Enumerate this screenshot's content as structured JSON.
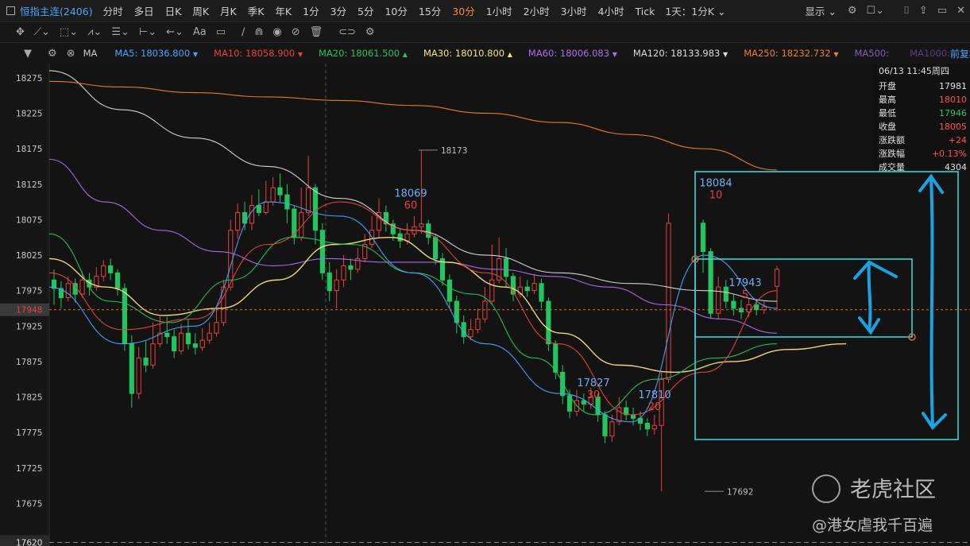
{
  "topbar": {
    "title": "恒指主连(2406)",
    "timeframes": [
      "分时",
      "多日",
      "日K",
      "周K",
      "月K",
      "季K",
      "年K",
      "1分",
      "3分",
      "5分",
      "10分",
      "15分",
      "30分",
      "1小时",
      "2小时",
      "3小时",
      "4小时",
      "Tick"
    ],
    "active_timeframe": "30分",
    "period_select": "1天：1分K",
    "display_label": "显示"
  },
  "mabar": {
    "ma_label": "MA",
    "items": [
      {
        "label": "MA5:",
        "value": "18036.800",
        "color": "#4aa3ff",
        "arrow": "▼"
      },
      {
        "label": "MA10:",
        "value": "18058.900",
        "color": "#e8413a",
        "arrow": "▼"
      },
      {
        "label": "MA20:",
        "value": "18061.500",
        "color": "#22c55e",
        "arrow": "▲"
      },
      {
        "label": "MA30:",
        "value": "18010.800",
        "color": "#f5e27a",
        "arrow": "▲"
      },
      {
        "label": "MA60:",
        "value": "18006.083",
        "color": "#b06cf0",
        "arrow": "▼"
      },
      {
        "label": "MA120:",
        "value": "18133.983",
        "color": "#dcdcdc",
        "arrow": "▼"
      },
      {
        "label": "MA250:",
        "value": "18232.732",
        "color": "#f07e22",
        "arrow": "▼"
      },
      {
        "label": "MA500:",
        "value": "",
        "color": "#8a5ab8",
        "arrow": ""
      }
    ],
    "ma1000_label": "MA1000:",
    "restore_label": "前复权"
  },
  "info_panel": {
    "datetime": "06/13 11:45周四",
    "rows": [
      {
        "label": "开盘",
        "value": "17981",
        "color": "#e0e0e0"
      },
      {
        "label": "最高",
        "value": "18010",
        "color": "#ff4d4d"
      },
      {
        "label": "最低",
        "value": "17946",
        "color": "#22c55e"
      },
      {
        "label": "收盘",
        "value": "18005",
        "color": "#ff4d4d"
      },
      {
        "label": "涨跌额",
        "value": "+24",
        "color": "#ff4d4d"
      },
      {
        "label": "涨跌幅",
        "value": "+0.13%",
        "color": "#ff4d4d"
      },
      {
        "label": "成交量",
        "value": "4304",
        "color": "#e0e0e0"
      }
    ]
  },
  "chart_data": {
    "type": "candlestick",
    "y_ticks": [
      18275,
      18225,
      18175,
      18125,
      18075,
      18025,
      17975,
      17925,
      17875,
      17825,
      17775,
      17725,
      17675
    ],
    "ylim": [
      17615,
      18295
    ],
    "current_price": "17948",
    "bottom_price": "17620",
    "up_color": "#e8413a",
    "down_color": "#22c55e",
    "candles": [
      [
        17990,
        17978,
        18005,
        17955
      ],
      [
        17978,
        17965,
        17988,
        17950
      ],
      [
        17965,
        17985,
        17995,
        17960
      ],
      [
        17985,
        17970,
        17992,
        17958
      ],
      [
        17970,
        17990,
        18002,
        17965
      ],
      [
        17990,
        17980,
        18000,
        17968
      ],
      [
        17980,
        17995,
        18008,
        17975
      ],
      [
        17995,
        18010,
        18018,
        17988
      ],
      [
        18010,
        18000,
        18020,
        17990
      ],
      [
        18000,
        17978,
        18005,
        17968
      ],
      [
        17978,
        17900,
        17985,
        17890
      ],
      [
        17900,
        17830,
        17912,
        17810
      ],
      [
        17830,
        17880,
        17895,
        17822
      ],
      [
        17880,
        17870,
        17905,
        17860
      ],
      [
        17870,
        17900,
        17930,
        17865
      ],
      [
        17900,
        17915,
        17940,
        17895
      ],
      [
        17915,
        17910,
        17938,
        17900
      ],
      [
        17910,
        17890,
        17920,
        17880
      ],
      [
        17890,
        17915,
        17928,
        17885
      ],
      [
        17915,
        17900,
        17935,
        17892
      ],
      [
        17900,
        17895,
        17915,
        17885
      ],
      [
        17895,
        17905,
        17922,
        17890
      ],
      [
        17905,
        17915,
        17930,
        17900
      ],
      [
        17915,
        17930,
        17950,
        17910
      ],
      [
        17930,
        17980,
        17990,
        17925
      ],
      [
        17980,
        18060,
        18075,
        17975
      ],
      [
        18060,
        18085,
        18098,
        18048
      ],
      [
        18085,
        18070,
        18100,
        18060
      ],
      [
        18070,
        18095,
        18110,
        18060
      ],
      [
        18095,
        18085,
        18118,
        18080
      ],
      [
        18085,
        18100,
        18130,
        18082
      ],
      [
        18100,
        18120,
        18135,
        18095
      ],
      [
        18120,
        18110,
        18140,
        18100
      ],
      [
        18110,
        18090,
        18125,
        18070
      ],
      [
        18090,
        18050,
        18095,
        18040
      ],
      [
        18050,
        18085,
        18120,
        18045
      ],
      [
        18085,
        18120,
        18165,
        18080
      ],
      [
        18120,
        18060,
        18125,
        18040
      ],
      [
        18060,
        18000,
        18070,
        17990
      ],
      [
        18000,
        17975,
        18015,
        17960
      ],
      [
        17975,
        17990,
        18005,
        17950
      ],
      [
        17990,
        18010,
        18025,
        17980
      ],
      [
        18010,
        18005,
        18020,
        17990
      ],
      [
        18005,
        18020,
        18035,
        18000
      ],
      [
        18020,
        18040,
        18055,
        18015
      ],
      [
        18040,
        18060,
        18080,
        18035
      ],
      [
        18060,
        18085,
        18105,
        18050
      ],
      [
        18085,
        18069,
        18095,
        18058
      ],
      [
        18069,
        18055,
        18075,
        18045
      ],
      [
        18055,
        18045,
        18062,
        18035
      ],
      [
        18045,
        18055,
        18070,
        18040
      ],
      [
        18055,
        18065,
        18080,
        18050
      ],
      [
        18065,
        18069,
        18173,
        18055
      ],
      [
        18069,
        18050,
        18075,
        18040
      ],
      [
        18050,
        18020,
        18055,
        18012
      ],
      [
        18020,
        17990,
        18028,
        17982
      ],
      [
        17990,
        17960,
        17998,
        17950
      ],
      [
        17960,
        17930,
        17968,
        17915
      ],
      [
        17930,
        17910,
        17940,
        17900
      ],
      [
        17910,
        17920,
        17935,
        17905
      ],
      [
        17920,
        17935,
        17950,
        17915
      ],
      [
        17935,
        17960,
        17980,
        17930
      ],
      [
        17960,
        17990,
        18040,
        17955
      ],
      [
        17990,
        18020,
        18050,
        17985
      ],
      [
        18020,
        17995,
        18035,
        17980
      ],
      [
        17995,
        17970,
        18000,
        17960
      ],
      [
        17970,
        17980,
        17995,
        17965
      ],
      [
        17980,
        17975,
        17990,
        17966
      ],
      [
        17975,
        17985,
        17998,
        17970
      ],
      [
        17985,
        17960,
        17992,
        17950
      ],
      [
        17960,
        17900,
        17965,
        17890
      ],
      [
        17900,
        17860,
        17905,
        17850
      ],
      [
        17860,
        17827,
        17870,
        17815
      ],
      [
        17827,
        17805,
        17835,
        17795
      ],
      [
        17805,
        17820,
        17835,
        17798
      ],
      [
        17820,
        17815,
        17830,
        17805
      ],
      [
        17815,
        17825,
        17838,
        17808
      ],
      [
        17825,
        17800,
        17830,
        17790
      ],
      [
        17800,
        17770,
        17805,
        17760
      ],
      [
        17770,
        17790,
        17800,
        17762
      ],
      [
        17790,
        17810,
        17825,
        17785
      ],
      [
        17810,
        17800,
        17820,
        17792
      ],
      [
        17800,
        17795,
        17810,
        17785
      ],
      [
        17795,
        17788,
        17805,
        17778
      ],
      [
        17788,
        17780,
        17795,
        17770
      ],
      [
        17780,
        17785,
        17800,
        17772
      ],
      [
        17785,
        17850,
        17860,
        17692
      ],
      [
        17850,
        18070,
        18084,
        17845
      ],
      [
        18070,
        18030,
        18075,
        18000
      ],
      [
        18030,
        17943,
        18035,
        17935
      ],
      [
        17943,
        17980,
        17995,
        17935
      ],
      [
        17980,
        17960,
        17990,
        17950
      ],
      [
        17960,
        17950,
        17970,
        17940
      ],
      [
        17950,
        17945,
        17962,
        17935
      ],
      [
        17945,
        17955,
        17965,
        17938
      ],
      [
        17955,
        17948,
        17962,
        17940
      ],
      [
        17948,
        17952,
        17960,
        17942
      ],
      [
        17981,
        18005,
        18010,
        17946
      ]
    ],
    "ma_series": [
      {
        "name": "MA120",
        "color": "#dcdcdc",
        "values": [
          18285,
          18230,
          18190,
          18150,
          18105,
          18060,
          18025,
          18000,
          17985,
          17975,
          17960
        ]
      },
      {
        "name": "MA250",
        "color": "#f07e22",
        "values": [
          18270,
          18262,
          18254,
          18248,
          18243,
          18236,
          18225,
          18212,
          18195,
          18175,
          18145
        ]
      },
      {
        "name": "MA60",
        "color": "#b06cf0",
        "values": [
          18160,
          18100,
          18060,
          18030,
          18010,
          18020,
          18015,
          18015,
          18005,
          17995,
          17980,
          17955,
          17935,
          17915
        ]
      },
      {
        "name": "MA30",
        "color": "#f5e27a",
        "values": [
          18020,
          17980,
          17940,
          17950,
          17990,
          18040,
          18050,
          18015,
          17980,
          17915,
          17870,
          17860,
          17875,
          17892,
          17900
        ]
      },
      {
        "name": "MA20",
        "color": "#22c55e",
        "values": [
          18055,
          17960,
          17930,
          17990,
          18050,
          18040,
          18000,
          17970,
          17880,
          17800,
          17850,
          17880,
          17900
        ]
      },
      {
        "name": "MA10",
        "color": "#e8413a",
        "values": [
          18000,
          17920,
          17935,
          18040,
          18100,
          18060,
          18000,
          17900,
          17800,
          17860,
          17975
        ]
      },
      {
        "name": "MA5",
        "color": "#4aa3ff",
        "values": [
          17980,
          17900,
          17925,
          18100,
          18080,
          18000,
          17900,
          17830,
          17790,
          18025,
          17950
        ]
      }
    ],
    "annotations": [
      {
        "price": "18173",
        "label": "18173",
        "color": "#bdbdbd"
      },
      {
        "price": "18069",
        "label": "18069",
        "sub": "60",
        "color": "#6aaef5"
      },
      {
        "price": "18084",
        "label": "18084",
        "sub": "10",
        "color": "#6aaef5"
      },
      {
        "price": "17943",
        "label": "17943",
        "sub": "5",
        "color": "#6aaef5"
      },
      {
        "price": "17827",
        "label": "17827",
        "sub": "30",
        "color": "#6aaef5"
      },
      {
        "price": "17810",
        "label": "17810",
        "sub": "20",
        "color": "#6aaef5"
      },
      {
        "price": "17692",
        "label": "17692",
        "color": "#bdbdbd"
      }
    ]
  },
  "watermark": {
    "brand": "老虎社区",
    "author": "@港女虐我千百遍"
  }
}
